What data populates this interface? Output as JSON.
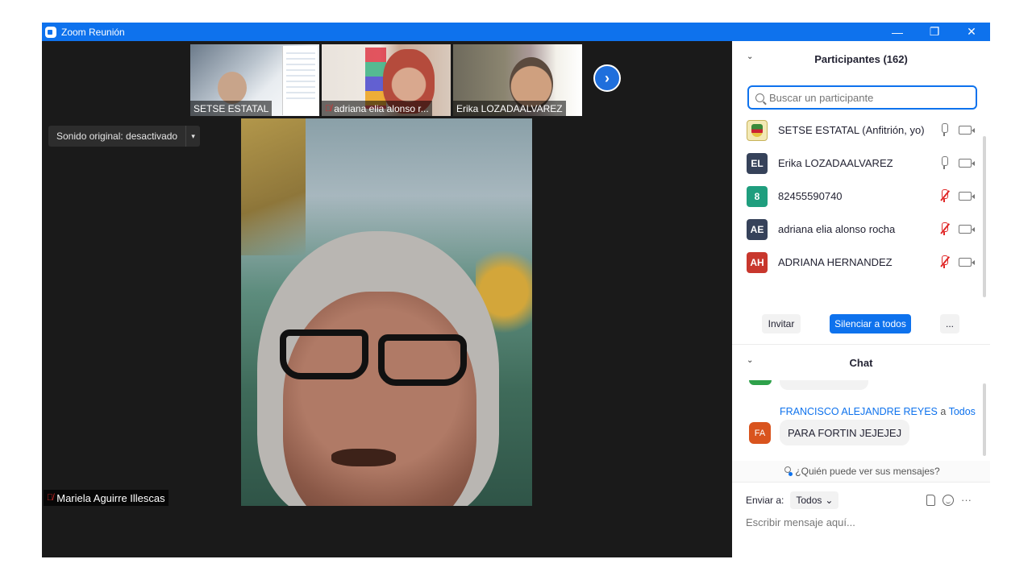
{
  "window": {
    "title": "Zoom Reunión",
    "minimize": "—",
    "restore": "❐",
    "close": "✕"
  },
  "video": {
    "thumbnails": [
      {
        "name": "SETSE ESTATAL",
        "muted": false
      },
      {
        "name": "adriana elia alonso r...",
        "muted": true
      },
      {
        "name": "Erika LOZADAALVAREZ",
        "muted": false
      }
    ],
    "next_icon": "›",
    "sound_button": {
      "label": "Sonido original: desactivado",
      "caret": "▾"
    },
    "active_speaker": {
      "name": "Mariela Aguirre Illescas",
      "muted": true
    }
  },
  "participants": {
    "header": "Participantes (162)",
    "search_placeholder": "Buscar un participante",
    "list": [
      {
        "initials": "",
        "name": "SETSE ESTATAL (Anfitrión, yo)",
        "avatar_color": "#f3e9b5",
        "mic": "on"
      },
      {
        "initials": "EL",
        "name": "Erika LOZADAALVAREZ",
        "avatar_color": "#36425a",
        "mic": "on"
      },
      {
        "initials": "8",
        "name": "82455590740",
        "avatar_color": "#1f9e7e",
        "mic": "muted"
      },
      {
        "initials": "AE",
        "name": "adriana elia alonso rocha",
        "avatar_color": "#36425a",
        "mic": "muted"
      },
      {
        "initials": "AH",
        "name": "ADRIANA HERNANDEZ",
        "avatar_color": "#c8372d",
        "mic": "muted"
      }
    ],
    "buttons": {
      "invite": "Invitar",
      "mute_all": "Silenciar a todos",
      "more": "..."
    }
  },
  "chat": {
    "header": "Chat",
    "message": {
      "from": "FRANCISCO ALEJANDRE REYES",
      "connector": "a",
      "to": "Todos",
      "initials": "FA",
      "text": "PARA FORTIN JEJEJEJ"
    },
    "privacy_note": "¿Quién puede ver sus mensajes?",
    "send_to_label": "Enviar a:",
    "send_to_value": "Todos",
    "more_icon": "···",
    "compose_placeholder": "Escribir mensaje aquí..."
  }
}
